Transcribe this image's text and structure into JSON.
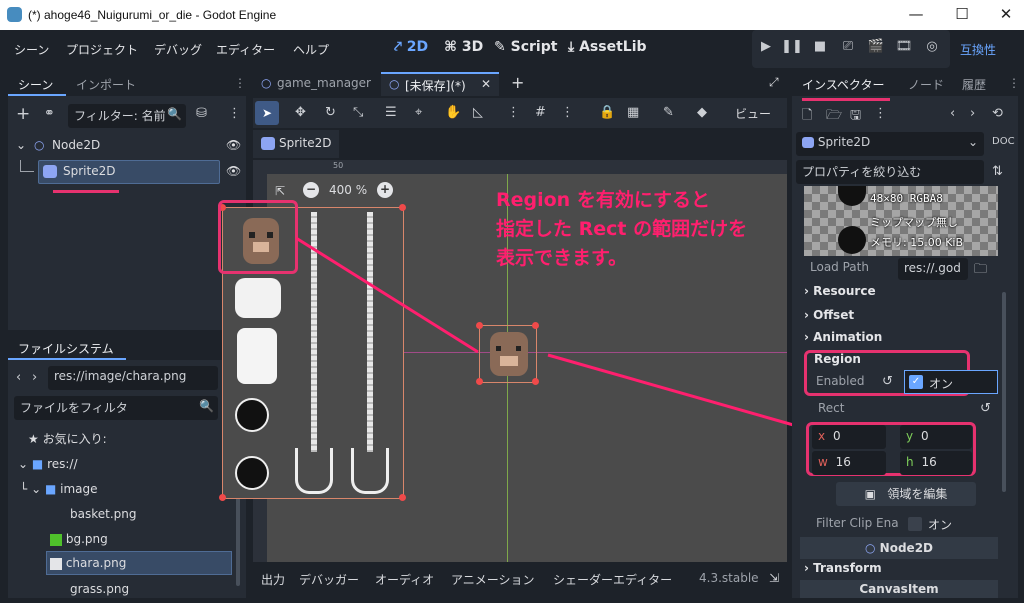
{
  "window": {
    "title": "(*) ahoge46_Nuigurumi_or_die - Godot Engine",
    "minimize": "—",
    "maximize": "☐",
    "close": "✕"
  },
  "menus": [
    "シーン",
    "プロジェクト",
    "デバッグ",
    "エディター",
    "ヘルプ"
  ],
  "modes": {
    "m2d": "2D",
    "m3d": "3D",
    "script": "Script",
    "assetlib": "AssetLib"
  },
  "renderer": "互換性",
  "scene_dock": {
    "tabs": [
      "シーン",
      "インポート"
    ],
    "filter_placeholder": "フィルター: 名前",
    "nodes": [
      {
        "name": "Node2D"
      },
      {
        "name": "Sprite2D"
      }
    ]
  },
  "filesystem": {
    "tab": "ファイルシステム",
    "path": "res://image/chara.png",
    "filter_placeholder": "ファイルをフィルタ",
    "favorites": "お気に入り:",
    "items": [
      {
        "label": "res://"
      },
      {
        "label": "image"
      },
      {
        "label": "basket.png"
      },
      {
        "label": "bg.png"
      },
      {
        "label": "chara.png"
      },
      {
        "label": "grass.png"
      }
    ]
  },
  "editor": {
    "tabs": [
      {
        "label": "game_manager"
      },
      {
        "label": "[未保存](*)"
      }
    ],
    "view_label": "ビュー",
    "selected_node_tab": "Sprite2D",
    "zoom": "400 %",
    "ruler_mark": "50"
  },
  "annotation": {
    "line1": "Region を有効にすると",
    "line2": "指定した Rect の範囲だけを",
    "line3": "表示できます。"
  },
  "bottom_tabs": [
    "出力",
    "デバッガー",
    "オーディオ",
    "アニメーション",
    "シェーダーエディター"
  ],
  "version": "4.3.stable",
  "inspector": {
    "tabs": [
      "インスペクター",
      "ノード",
      "履歴"
    ],
    "node": "Sprite2D",
    "filter_placeholder": "プロパティを絞り込む",
    "tex_info": {
      "fmt": "48×80 RGBA8",
      "mip": "ミップマップ無し",
      "mem": "メモリ: 15.00 KiB"
    },
    "load_path_label": "Load Path",
    "load_path_value": "res://.god",
    "sections": {
      "resource": "Resource",
      "offset": "Offset",
      "animation": "Animation",
      "region": "Region"
    },
    "region": {
      "enabled_label": "Enabled",
      "enabled_value": "オン",
      "rect_label": "Rect",
      "x_label": "x",
      "x": "0",
      "y_label": "y",
      "y": "0",
      "w_label": "w",
      "w": "16",
      "h_label": "h",
      "h": "16",
      "edit_button": "領域を編集",
      "filter_clip_label": "Filter Clip Ena",
      "filter_clip_value": "オン"
    },
    "node2d": "Node2D",
    "transform": "Transform",
    "canvas_item": "CanvasItem"
  }
}
